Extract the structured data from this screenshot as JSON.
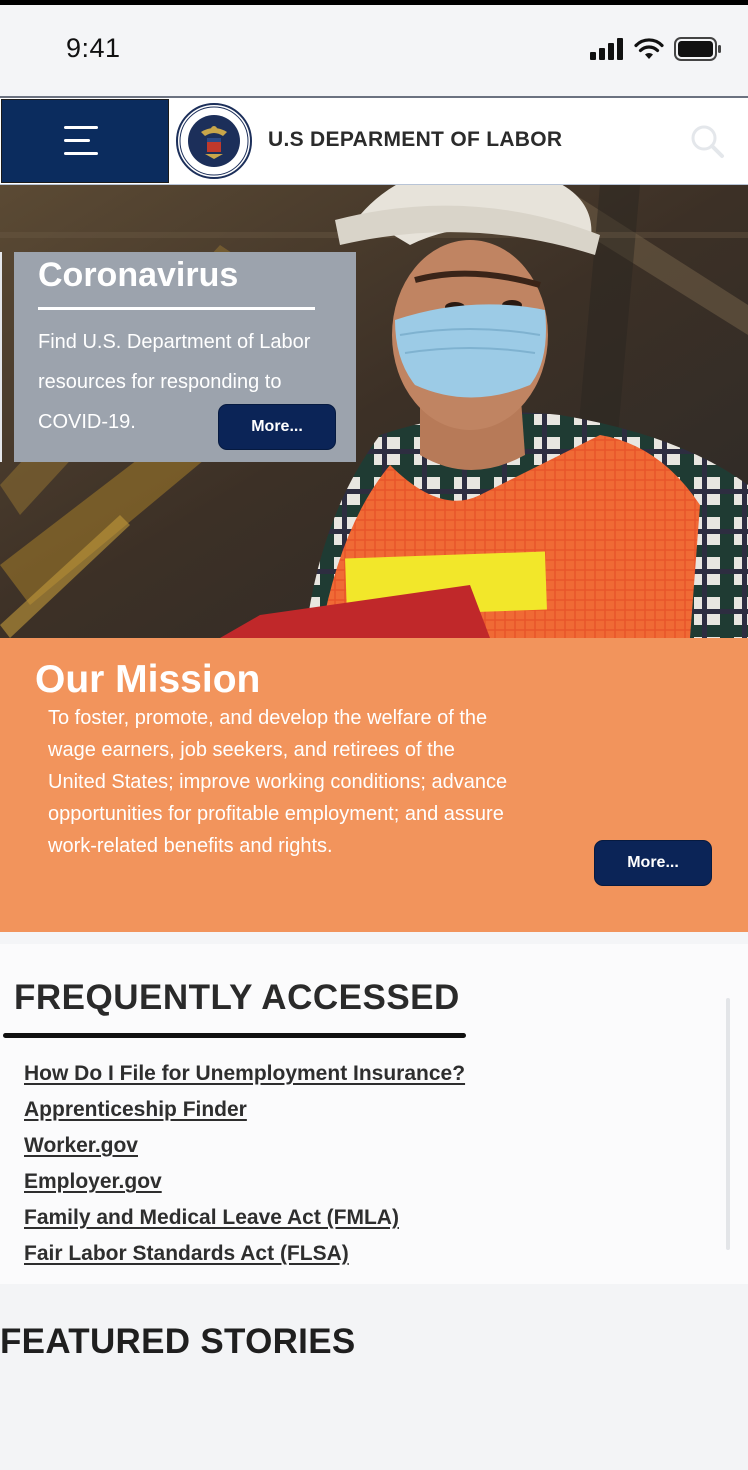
{
  "status_bar": {
    "time": "9:41"
  },
  "header": {
    "site_title": "U.S DEPARMENT OF LABOR",
    "menu_icon": "hamburger-menu-icon",
    "seal": "department-of-labor-seal",
    "search_icon": "search-icon"
  },
  "hero": {
    "title": "Coronavirus",
    "text": "Find U.S. Department of Labor resources for responding to COVID-19.",
    "button_label": "More..."
  },
  "mission": {
    "title": "Our Mission",
    "text": "To foster, promote, and develop the welfare of the wage earners, job seekers, and retirees of the United States; improve working conditions; advance opportunities for profitable employment; and assure work-related benefits and rights.",
    "button_label": "More..."
  },
  "frequently_accessed": {
    "title": "FREQUENTLY ACCESSED",
    "links": [
      "How Do I File for Unemployment Insurance?",
      "Apprenticeship Finder",
      "Worker.gov",
      "Employer.gov",
      "Family and Medical Leave Act (FMLA)",
      "Fair Labor Standards Act (FLSA)"
    ]
  },
  "featured": {
    "title": "FEATURED STORIES"
  },
  "colors": {
    "navy": "#0b2c5e",
    "mission_orange": "#f2945c",
    "hero_card_gray": "#9ca3ad",
    "button_navy": "#0b2457"
  }
}
